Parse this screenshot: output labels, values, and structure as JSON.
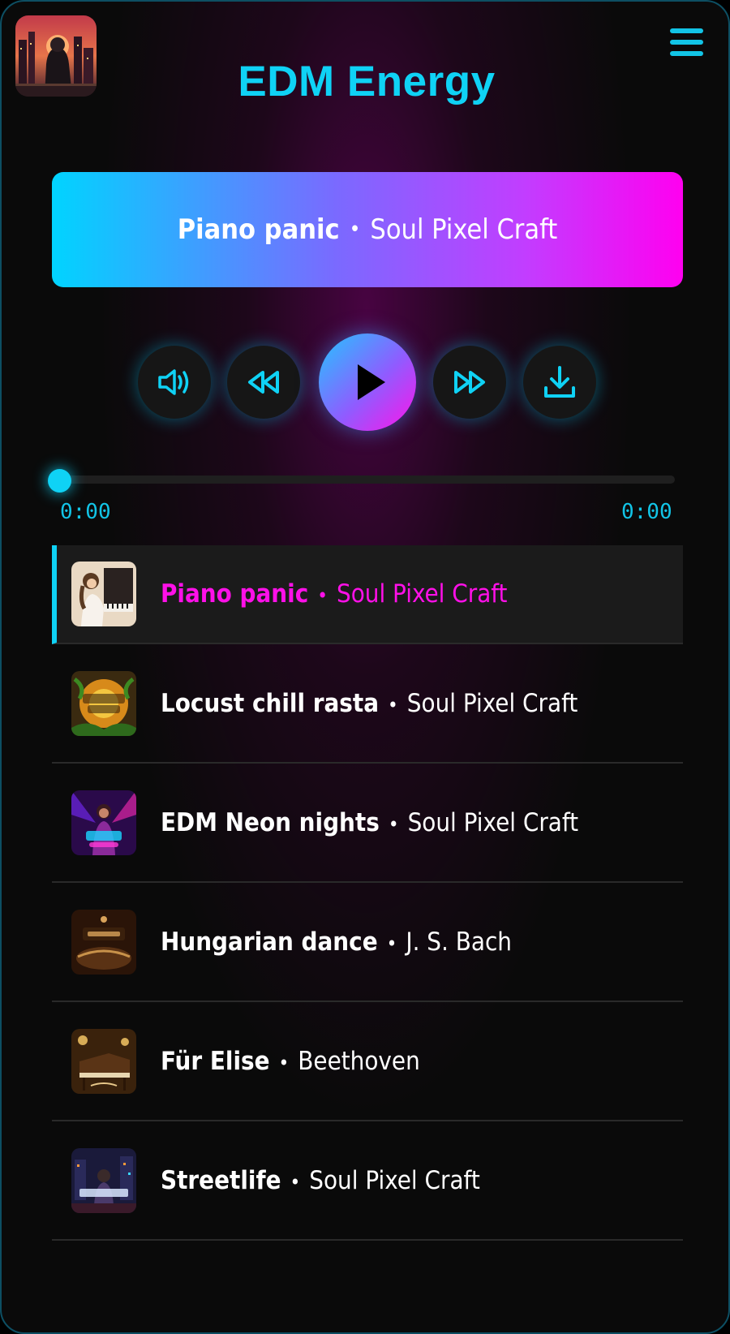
{
  "header": {
    "title": "EDM Energy",
    "avatar_icon": "city-night-avatar-icon",
    "menu_icon": "hamburger-menu-icon"
  },
  "now_playing": {
    "title": "Piano panic",
    "separator": "•",
    "artist": "Soul Pixel Craft"
  },
  "controls": {
    "volume_icon": "volume-icon",
    "rewind_icon": "rewind-icon",
    "play_icon": "play-icon",
    "forward_icon": "fast-forward-icon",
    "download_icon": "download-icon"
  },
  "progress": {
    "current_time": "0:00",
    "duration": "0:00",
    "fraction": 0
  },
  "playlist": [
    {
      "title": "Piano panic",
      "separator": "•",
      "artist": "Soul Pixel Craft",
      "active": true,
      "thumb": "piano-girl-thumb"
    },
    {
      "title": "Locust chill rasta",
      "separator": "•",
      "artist": "Soul Pixel Craft",
      "active": false,
      "thumb": "locust-chill-thumb"
    },
    {
      "title": "EDM Neon nights",
      "separator": "•",
      "artist": "Soul Pixel Craft",
      "active": false,
      "thumb": "edm-neon-thumb"
    },
    {
      "title": "Hungarian dance",
      "separator": "•",
      "artist": "J. S. Bach",
      "active": false,
      "thumb": "bach-thumb"
    },
    {
      "title": "Für Elise",
      "separator": "•",
      "artist": "Beethoven",
      "active": false,
      "thumb": "fur-elise-thumb"
    },
    {
      "title": "Streetlife",
      "separator": "•",
      "artist": "Soul Pixel Craft",
      "active": false,
      "thumb": "streetlife-thumb"
    }
  ],
  "colors": {
    "accent_cyan": "#0fd2f5",
    "accent_magenta": "#ff10e8",
    "background": "#0a0a0a"
  }
}
